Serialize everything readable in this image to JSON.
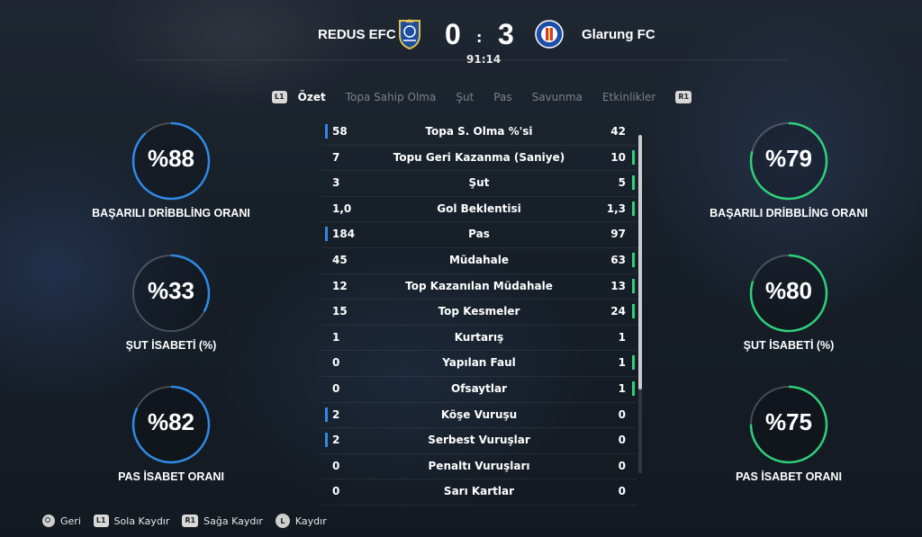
{
  "match": {
    "home_team": "REDUS EFC",
    "away_team": "Glarung FC",
    "home_score": "0",
    "away_score": "3",
    "separator": ":",
    "clock": "91:14"
  },
  "tabs": {
    "left_button": "L1",
    "right_button": "R1",
    "items": [
      "Özet",
      "Topa Sahip Olma",
      "Şut",
      "Pas",
      "Savunma",
      "Etkinlikler"
    ],
    "active": "Özet"
  },
  "stats": [
    {
      "label": "Topa S. Olma %'si",
      "home": "58",
      "away": "42",
      "lead": "home"
    },
    {
      "label": "Topu Geri Kazanma (Saniye)",
      "home": "7",
      "away": "10",
      "lead": "away"
    },
    {
      "label": "Şut",
      "home": "3",
      "away": "5",
      "lead": "away"
    },
    {
      "label": "Gol Beklentisi",
      "home": "1,0",
      "away": "1,3",
      "lead": "away"
    },
    {
      "label": "Pas",
      "home": "184",
      "away": "97",
      "lead": "home"
    },
    {
      "label": "Müdahale",
      "home": "45",
      "away": "63",
      "lead": "away"
    },
    {
      "label": "Top Kazanılan Müdahale",
      "home": "12",
      "away": "13",
      "lead": "away"
    },
    {
      "label": "Top Kesmeler",
      "home": "15",
      "away": "24",
      "lead": "away"
    },
    {
      "label": "Kurtarış",
      "home": "1",
      "away": "1",
      "lead": "none"
    },
    {
      "label": "Yapılan Faul",
      "home": "0",
      "away": "1",
      "lead": "away"
    },
    {
      "label": "Ofsaytlar",
      "home": "0",
      "away": "1",
      "lead": "away"
    },
    {
      "label": "Köşe Vuruşu",
      "home": "2",
      "away": "0",
      "lead": "home"
    },
    {
      "label": "Serbest Vuruşlar",
      "home": "2",
      "away": "0",
      "lead": "home"
    },
    {
      "label": "Penaltı Vuruşları",
      "home": "0",
      "away": "0",
      "lead": "none"
    },
    {
      "label": "Sarı Kartlar",
      "home": "0",
      "away": "0",
      "lead": "none"
    }
  ],
  "gauges": {
    "home": [
      {
        "value": "%88",
        "label": "BAŞARILI DRİBBLİNG ORANI",
        "pct": 88
      },
      {
        "value": "%33",
        "label": "ŞUT İSABETİ (%)",
        "pct": 33
      },
      {
        "value": "%82",
        "label": "PAS İSABET ORANI",
        "pct": 82
      }
    ],
    "away": [
      {
        "value": "%79",
        "label": "BAŞARILI DRİBBLİNG ORANI",
        "pct": 79
      },
      {
        "value": "%80",
        "label": "ŞUT İSABETİ (%)",
        "pct": 80
      },
      {
        "value": "%75",
        "label": "PAS İSABET ORANI",
        "pct": 75
      }
    ]
  },
  "colors": {
    "home_accent": "#2e8ae6",
    "away_accent": "#2fd07a"
  },
  "footer": {
    "back": "Geri",
    "l1_chip": "L1",
    "l1_label": "Sola Kaydır",
    "r1_chip": "R1",
    "r1_label": "Sağa Kaydır",
    "l_stick": "L",
    "scroll_label": "Kaydır"
  }
}
